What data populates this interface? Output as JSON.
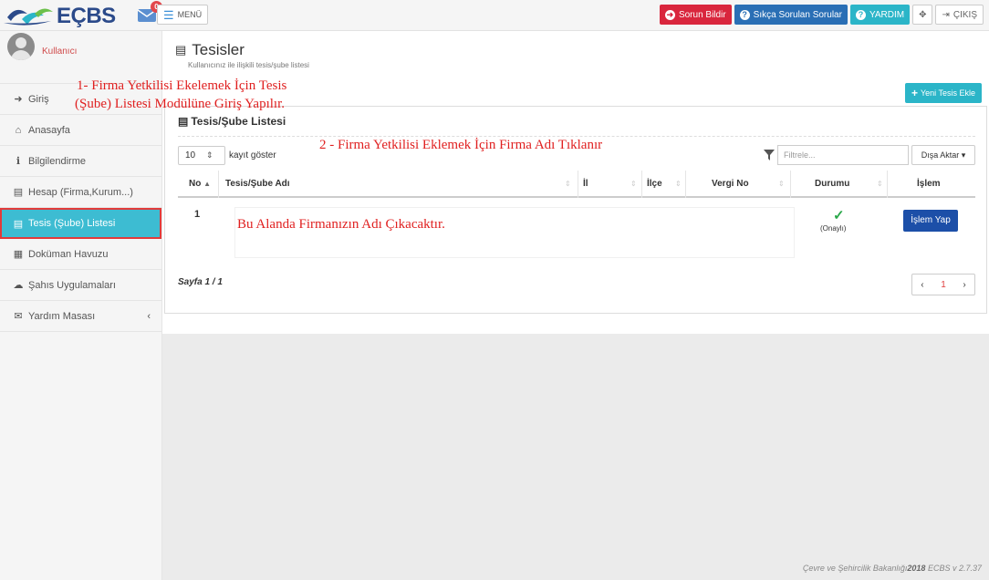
{
  "topbar": {
    "logo_text": "EÇBS",
    "message_count": "0",
    "menu_label": "MENÜ",
    "report_issue": "Sorun Bildir",
    "faq": "Sıkça Sorulan Sorular",
    "help": "YARDIM",
    "logout": "ÇIKIŞ"
  },
  "sidebar": {
    "user_name": "Kullanıcı",
    "items": [
      {
        "label": "Giriş",
        "icon": "sign-in-icon"
      },
      {
        "label": "Anasayfa",
        "icon": "home-icon"
      },
      {
        "label": "Bilgilendirme",
        "icon": "info-icon"
      },
      {
        "label": "Hesap (Firma,Kurum...)",
        "icon": "building-icon"
      },
      {
        "label": "Tesis (Şube) Listesi",
        "icon": "building-icon"
      },
      {
        "label": "Doküman Havuzu",
        "icon": "folder-icon"
      },
      {
        "label": "Şahıs Uygulamaları",
        "icon": "cloud-icon"
      },
      {
        "label": "Yardım Masası",
        "icon": "envelope-icon"
      }
    ]
  },
  "main": {
    "title": "Tesisler",
    "subtitle": "Kullanıcınız ile ilişkili tesis/şube listesi",
    "new_button": "Yeni Tesis Ekle",
    "panel_title": "Tesis/Şube Listesi",
    "page_length": "10",
    "page_length_label": "kayıt göster",
    "filter_placeholder": "Filtrele...",
    "export_label": "Dışa Aktar",
    "columns": [
      "No",
      "Tesis/Şube Adı",
      "İl",
      "İlçe",
      "Vergi No",
      "Durumu",
      "İşlem"
    ],
    "rows": [
      {
        "no": "1",
        "name": "Bu Alanda Firmanızın Adı Çıkacaktır.",
        "status": "(Onaylı)",
        "action": "İşlem Yap"
      }
    ],
    "page_info": "Sayfa 1 / 1",
    "current_page": "1"
  },
  "annotations": {
    "step1_line1": "1- Firma Yetkilisi Ekelemek İçin Tesis",
    "step1_line2": "(Şube) Listesi Modülüne Giriş Yapılır.",
    "step2": "2 - Firma Yetkilisi Eklemek İçin Firma Adı Tıklanır"
  },
  "footer": {
    "org": "Çevre ve Şehircilik Bakanlığı",
    "year": "2018",
    "version": "ECBS v 2.7.37"
  },
  "colors": {
    "accent_teal": "#2bb5c8",
    "danger_red": "#d9263d",
    "primary_blue": "#1c4fa8",
    "annotation_red": "#e02020"
  }
}
